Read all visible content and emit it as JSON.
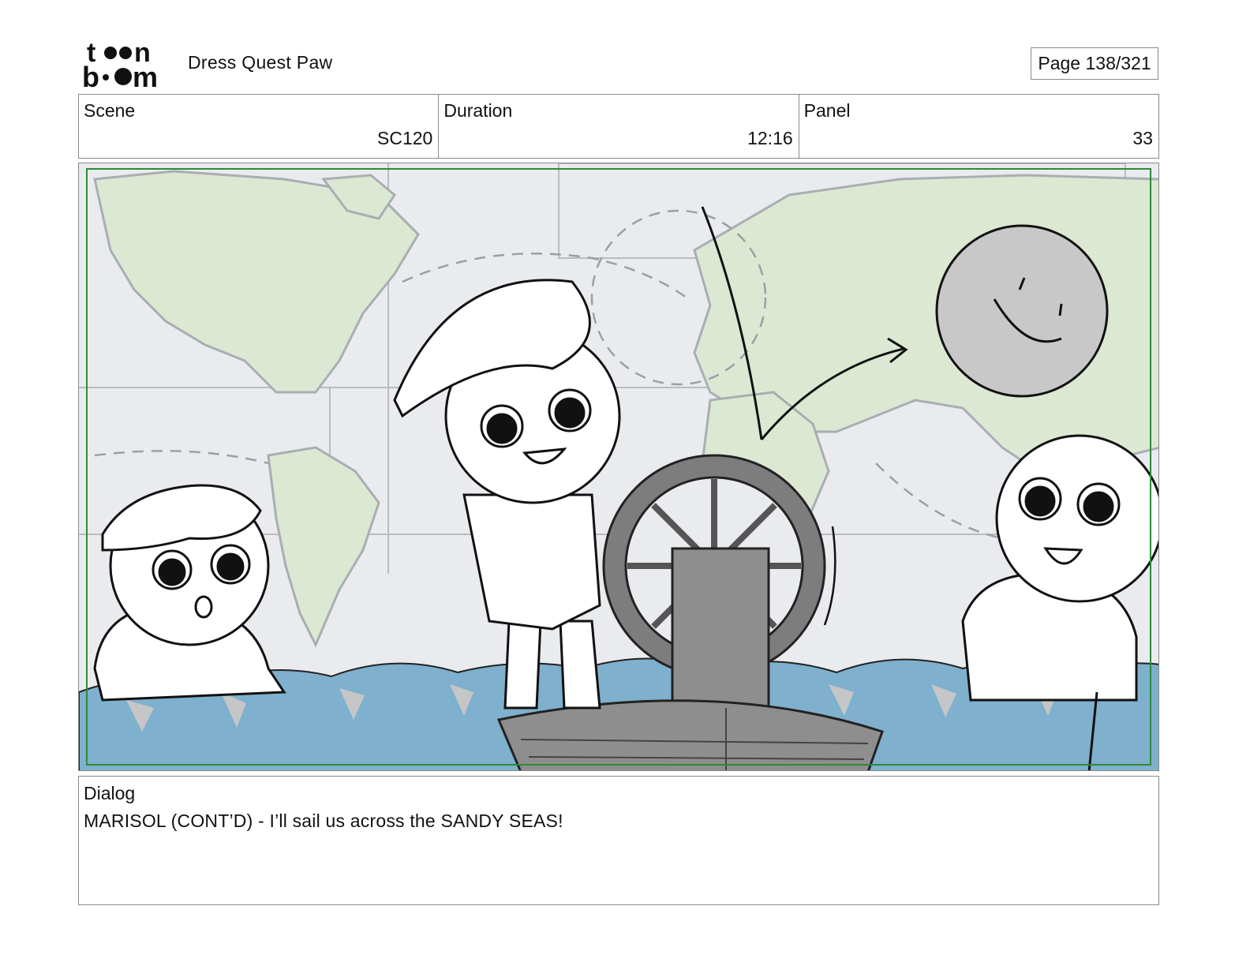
{
  "header": {
    "logo_text_top": "toon",
    "logo_text_bottom": "boom",
    "project_title": "Dress Quest Paw",
    "page_counter": "Page 138/321"
  },
  "info": {
    "scene_label": "Scene",
    "scene_value": "SC120",
    "duration_label": "Duration",
    "duration_value": "12:16",
    "panel_label": "Panel",
    "panel_value": "33"
  },
  "dialog": {
    "label": "Dialog",
    "text": "MARISOL (CONT’D) - I’ll sail us across the SANDY SEAS!"
  },
  "colors": {
    "map_land": "#dde8d3",
    "map_water": "#e9ebee",
    "sea": "#7fb0cd",
    "sun": "#c8c8c8",
    "boat": "#8e8e8e",
    "safe_frame": "#2e8b3a",
    "border": "#8a8a8a"
  }
}
